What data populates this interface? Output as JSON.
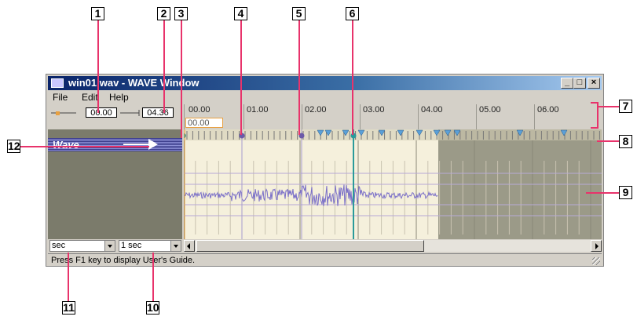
{
  "callouts": [
    "1",
    "2",
    "3",
    "4",
    "5",
    "6",
    "7",
    "8",
    "9",
    "10",
    "11",
    "12"
  ],
  "window": {
    "title": "win01.wav - WAVE Window",
    "min_label": "_",
    "max_label": "□",
    "close_label": "×"
  },
  "menu": {
    "file": "File",
    "edit": "Edit",
    "help": "Help"
  },
  "toolbar": {
    "start_time": "00.00",
    "end_time": "04.36"
  },
  "ruler": {
    "labels": [
      "00.00",
      "01.00",
      "02.00",
      "03.00",
      "04.00",
      "05.00",
      "06.00"
    ],
    "current_time": "00.00"
  },
  "track": {
    "label": "Wave"
  },
  "bottom": {
    "unit_select": "sec",
    "zoom_select": "1 sec"
  },
  "status": {
    "text": "Press F1 key to display User's Guide."
  },
  "colors": {
    "accent_leader": "#e8336b",
    "title_bar": "#0a246a",
    "wave_line": "#7a6fc8"
  }
}
